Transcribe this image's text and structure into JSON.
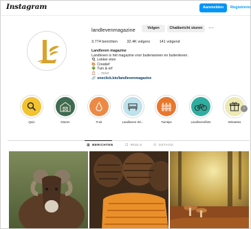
{
  "topbar": {
    "logo": "Instagram",
    "login_label": "Aanmelden",
    "register_label": "Registreren"
  },
  "profile": {
    "username": "landlevenmagazine",
    "follow_label": "Volgen",
    "message_label": "Chatbericht sturen",
    "more_label": "···",
    "stats": {
      "posts": "3.774 berichten",
      "followers": "32.4K volgers",
      "following": "141 volgend"
    },
    "bio": {
      "name": "Landleven magazine",
      "tagline": "Landleven is hét magazine voor buitenwonen en buitenleven.",
      "line1": "Lekker eten",
      "line2": "Creatief",
      "line3": "Tuin & erf",
      "more": "... meer",
      "link": "oneclick.bio/landlevenmagazine"
    }
  },
  "highlights": [
    {
      "label": "Quiz",
      "color": "#f2c230"
    },
    {
      "label": "Dieren",
      "color": "#3f6b52"
    },
    {
      "label": "Fruit",
      "color": "#ec8a45"
    },
    {
      "label": "Landleven Wi...",
      "color": "#bfe2ec"
    },
    {
      "label": "Tuintips",
      "color": "#e8772e"
    },
    {
      "label": "Landlevenfiets",
      "color": "#2fae9f"
    },
    {
      "label": "Winaetes",
      "color": "#ede9b4"
    }
  ],
  "tabs": {
    "posts": "BERICHTEN",
    "reels": "REELS",
    "tagged": "GETAGD"
  },
  "colors": {
    "accent": "#0095f6",
    "logo_gold": "#d8a32a"
  }
}
